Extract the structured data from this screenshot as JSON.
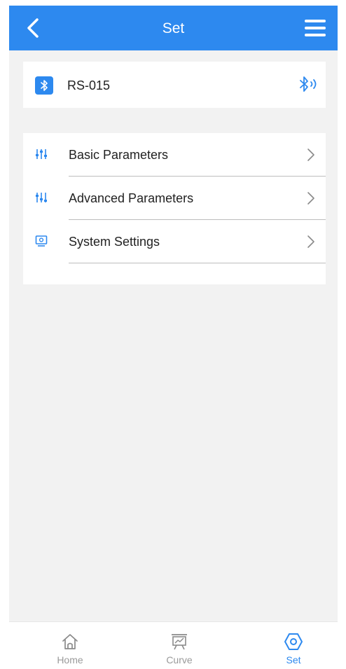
{
  "header": {
    "title": "Set",
    "back_icon": "chevron-left-icon",
    "menu_icon": "hamburger-menu-icon"
  },
  "device": {
    "name": "RS-015",
    "badge_icon": "bluetooth-icon",
    "status_icon": "bluetooth-connected-icon"
  },
  "menu": {
    "items": [
      {
        "label": "Basic Parameters",
        "icon": "sliders-icon"
      },
      {
        "label": "Advanced Parameters",
        "icon": "sliders-advanced-icon"
      },
      {
        "label": "System Settings",
        "icon": "monitor-icon"
      }
    ]
  },
  "tabbar": {
    "tabs": [
      {
        "label": "Home",
        "icon": "home-icon",
        "active": false
      },
      {
        "label": "Curve",
        "icon": "chart-board-icon",
        "active": false
      },
      {
        "label": "Set",
        "icon": "settings-hex-icon",
        "active": true
      }
    ]
  },
  "colors": {
    "primary": "#2d89ef",
    "background": "#f2f2f2",
    "card": "#ffffff",
    "text": "#222222",
    "muted": "#9a9a9a",
    "divider": "#bdbdbd"
  }
}
